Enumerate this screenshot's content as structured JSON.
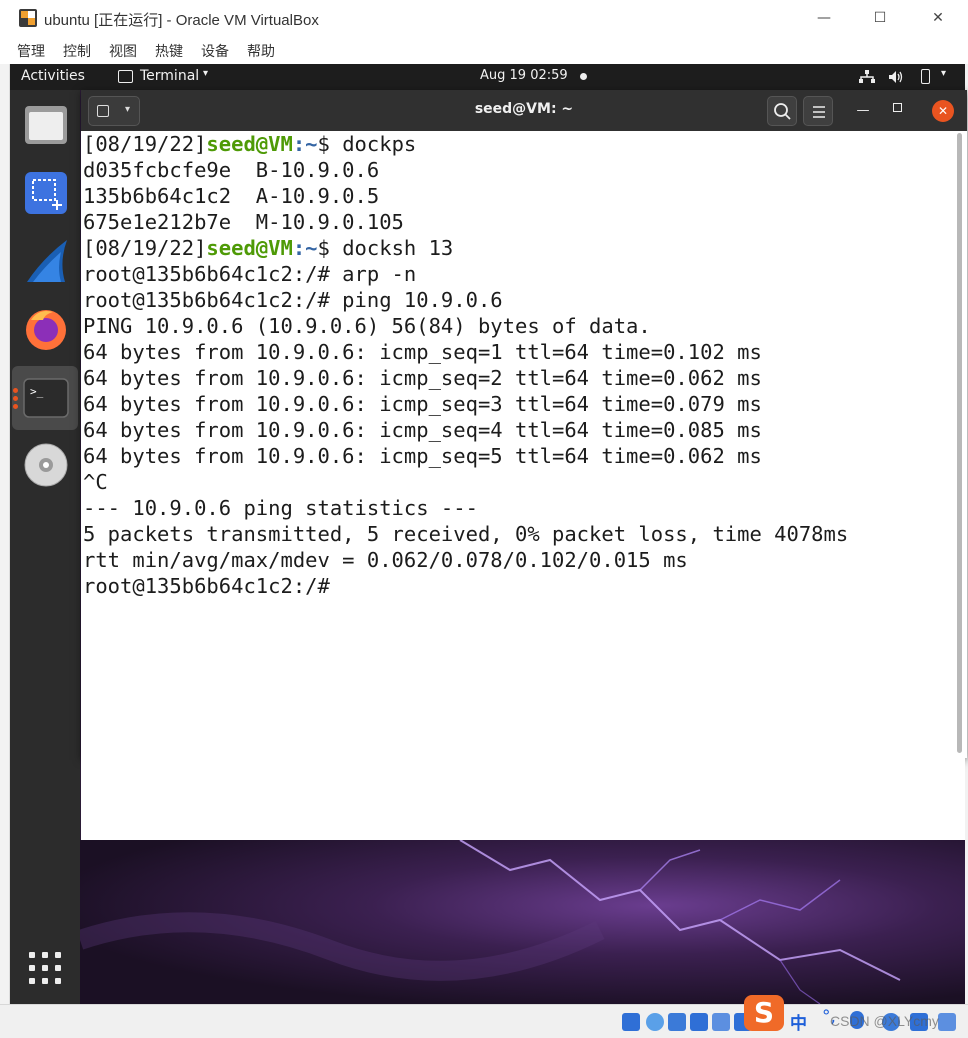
{
  "vbox": {
    "title": "ubuntu [正在运行] - Oracle VM VirtualBox",
    "menu": [
      "管理",
      "控制",
      "视图",
      "热键",
      "设备",
      "帮助"
    ],
    "controls": {
      "minimize": "—",
      "maximize": "☐",
      "close": "✕"
    }
  },
  "topbar": {
    "activities": "Activities",
    "app": "Terminal",
    "caret": "▾",
    "clock": "Aug 19  02:59",
    "tray_caret": "▾"
  },
  "terminal": {
    "title": "seed@VM: ~",
    "lines": [
      {
        "prompt_date": "[08/19/22]",
        "user": "seed@VM",
        "path": ":~",
        "rest": "$ dockps"
      },
      {
        "text": "d035fcbcfe9e  B-10.9.0.6"
      },
      {
        "text": "135b6b64c1c2  A-10.9.0.5"
      },
      {
        "text": "675e1e212b7e  M-10.9.0.105"
      },
      {
        "prompt_date": "[08/19/22]",
        "user": "seed@VM",
        "path": ":~",
        "rest": "$ docksh 13"
      },
      {
        "text": "root@135b6b64c1c2:/# arp -n"
      },
      {
        "text": "root@135b6b64c1c2:/# ping 10.9.0.6"
      },
      {
        "text": "PING 10.9.0.6 (10.9.0.6) 56(84) bytes of data."
      },
      {
        "text": "64 bytes from 10.9.0.6: icmp_seq=1 ttl=64 time=0.102 ms"
      },
      {
        "text": "64 bytes from 10.9.0.6: icmp_seq=2 ttl=64 time=0.062 ms"
      },
      {
        "text": "64 bytes from 10.9.0.6: icmp_seq=3 ttl=64 time=0.079 ms"
      },
      {
        "text": "64 bytes from 10.9.0.6: icmp_seq=4 ttl=64 time=0.085 ms"
      },
      {
        "text": "64 bytes from 10.9.0.6: icmp_seq=5 ttl=64 time=0.062 ms"
      },
      {
        "text": "^C"
      },
      {
        "text": "--- 10.9.0.6 ping statistics ---"
      },
      {
        "text": "5 packets transmitted, 5 received, 0% packet loss, time 4078ms"
      },
      {
        "text": "rtt min/avg/max/mdev = 0.062/0.078/0.102/0.015 ms"
      },
      {
        "text": "root@135b6b64c1c2:/# "
      }
    ]
  },
  "hoststatus": {
    "sogou": "S",
    "ime": "中",
    "ime_punct": "°,",
    "watermark": "CSDN @XLYcmy"
  },
  "colors": {
    "prompt_user": "#4e9a06",
    "prompt_path": "#3465a4",
    "accent": "#e95420"
  }
}
